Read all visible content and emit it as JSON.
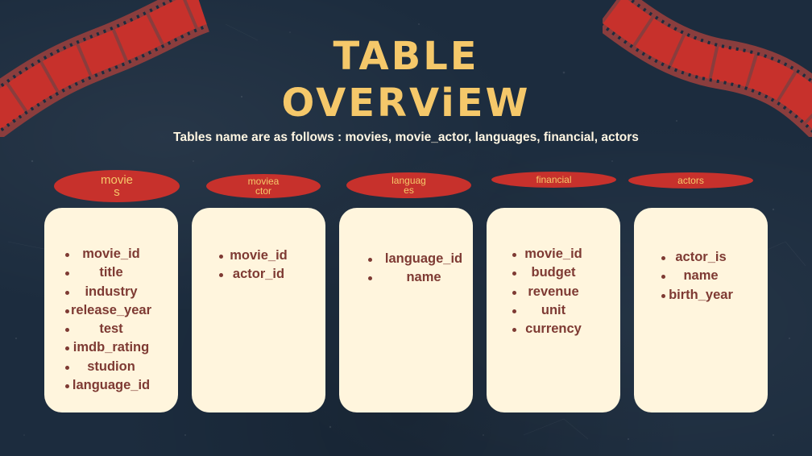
{
  "slide": {
    "title_line1": "TABLE",
    "title_line2": "OVERViEW",
    "subtitle": "Tables name are as follows : movies, movie_actor, languages, financial, actors"
  },
  "colors": {
    "background": "#1c2c3e",
    "title": "#f5c86a",
    "pill": "#c7312c",
    "card": "#fff5dd",
    "card_text": "#7e3a33",
    "film_strip": "#c7312c"
  },
  "tables": [
    {
      "label_lines": [
        "movie",
        "s"
      ],
      "columns": [
        "movie_id",
        "title",
        "industry",
        "release_year",
        "test",
        "imdb_rating",
        "studion",
        "language_id"
      ]
    },
    {
      "label_lines": [
        "moviea",
        "ctor"
      ],
      "columns": [
        "movie_id",
        "actor_id"
      ]
    },
    {
      "label_lines": [
        "languag",
        "es"
      ],
      "columns": [
        "language_id",
        "name"
      ]
    },
    {
      "label_lines": [
        "financial"
      ],
      "columns": [
        "movie_id",
        "budget",
        "revenue",
        "unit",
        "currency"
      ]
    },
    {
      "label_lines": [
        "actors"
      ],
      "columns": [
        "actor_is",
        "name",
        "birth_year"
      ]
    }
  ]
}
